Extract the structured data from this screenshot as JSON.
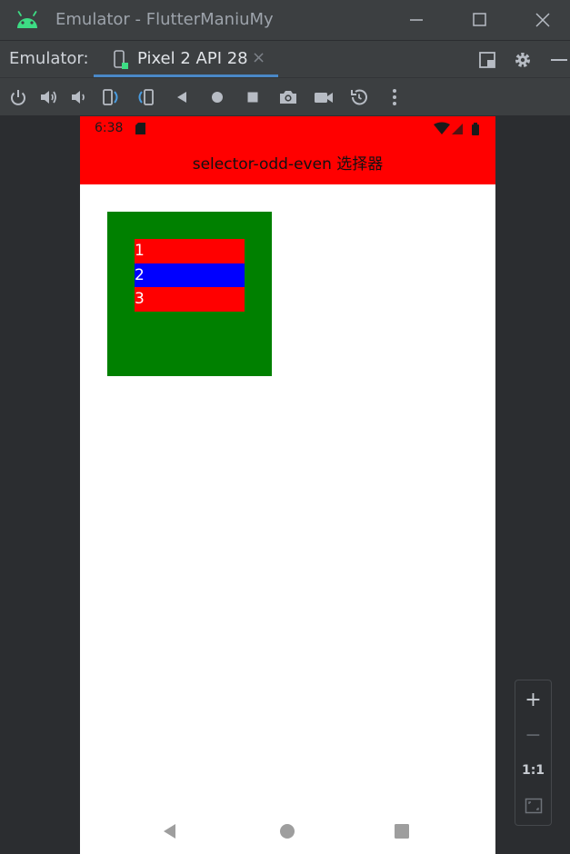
{
  "window": {
    "title": "Emulator - FlutterManiuMy"
  },
  "tabbar": {
    "label": "Emulator:",
    "tab_label": "Pixel 2 API 28",
    "tab_close": "×"
  },
  "device": {
    "status_time": "6:38",
    "app_title": "selector-odd-even 选择器",
    "list_items": [
      "1",
      "2",
      "3"
    ]
  },
  "zoom": {
    "zoom_in": "+",
    "zoom_out": "−",
    "actual_size": "1:1"
  },
  "colors": {
    "app_bar": "#ff0000",
    "container": "#008000",
    "odd_item": "#ff0000",
    "even_item": "#0000ff",
    "tab_underline": "#4a88c7"
  },
  "icons": {
    "window": [
      "android-icon",
      "minimize-icon",
      "maximize-icon",
      "close-icon"
    ],
    "tabbar": [
      "device-icon",
      "layout-icon",
      "settings-gear-icon",
      "hide-icon"
    ],
    "toolbar": [
      "power-icon",
      "volume-up-icon",
      "volume-down-icon",
      "rotate-left-icon",
      "rotate-right-icon",
      "back-icon",
      "home-icon",
      "overview-icon",
      "screenshot-camera-icon",
      "screenrecord-icon",
      "snapshot-icon",
      "more-icon"
    ],
    "navbar": [
      "nav-back-icon",
      "nav-home-icon",
      "nav-recents-icon"
    ]
  }
}
